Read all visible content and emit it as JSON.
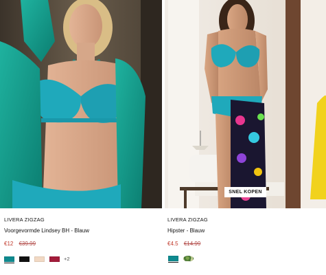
{
  "products": [
    {
      "brand": "LIVERA ZIGZAG",
      "title": "Voorgevormde Lindsey BH - Blauw",
      "price": "€12",
      "original_price": "€39.99",
      "swatches": [
        "#0e8a8f",
        "#111111",
        "#f2d9c4",
        "#a31c3a"
      ],
      "more": "+2"
    },
    {
      "brand": "LIVERA ZIGZAG",
      "title": "Hipster - Blauw",
      "price": "€4.5",
      "original_price": "€14.99",
      "swatches": [
        "#0e8a8f",
        "pattern"
      ],
      "quick_buy": "SNEL KOPEN"
    }
  ],
  "colors": {
    "sale": "#c0392b",
    "teal_product": "#1fa9bb"
  }
}
